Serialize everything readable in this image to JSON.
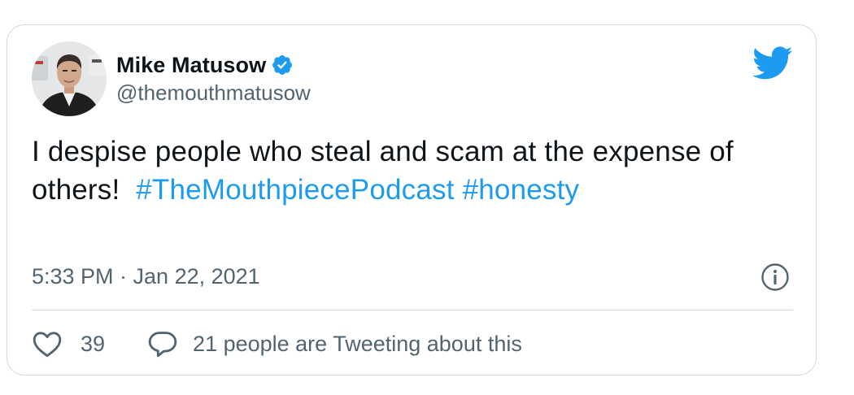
{
  "author": {
    "name": "Mike Matusow",
    "handle": "@themouthmatusow",
    "verified": true,
    "avatar_icon": "person-portrait"
  },
  "tweet": {
    "text_line": "I despise people who steal and scam at the expense of others!",
    "hashtags": [
      "#TheMouthpiecePodcast",
      "#honesty"
    ],
    "timestamp": "5:33 PM · Jan 22, 2021"
  },
  "actions": {
    "like_count": "39",
    "tweeting_text": "21 people are Tweeting about this"
  },
  "icons": {
    "brand": "twitter-bird",
    "verified": "verified-badge",
    "info": "info-circle",
    "like": "heart-outline",
    "reply": "speech-bubble"
  },
  "colors": {
    "brand_blue": "#1d9bf0",
    "text_primary": "#0f1419",
    "text_secondary": "#536471",
    "border": "#cfd9de"
  }
}
